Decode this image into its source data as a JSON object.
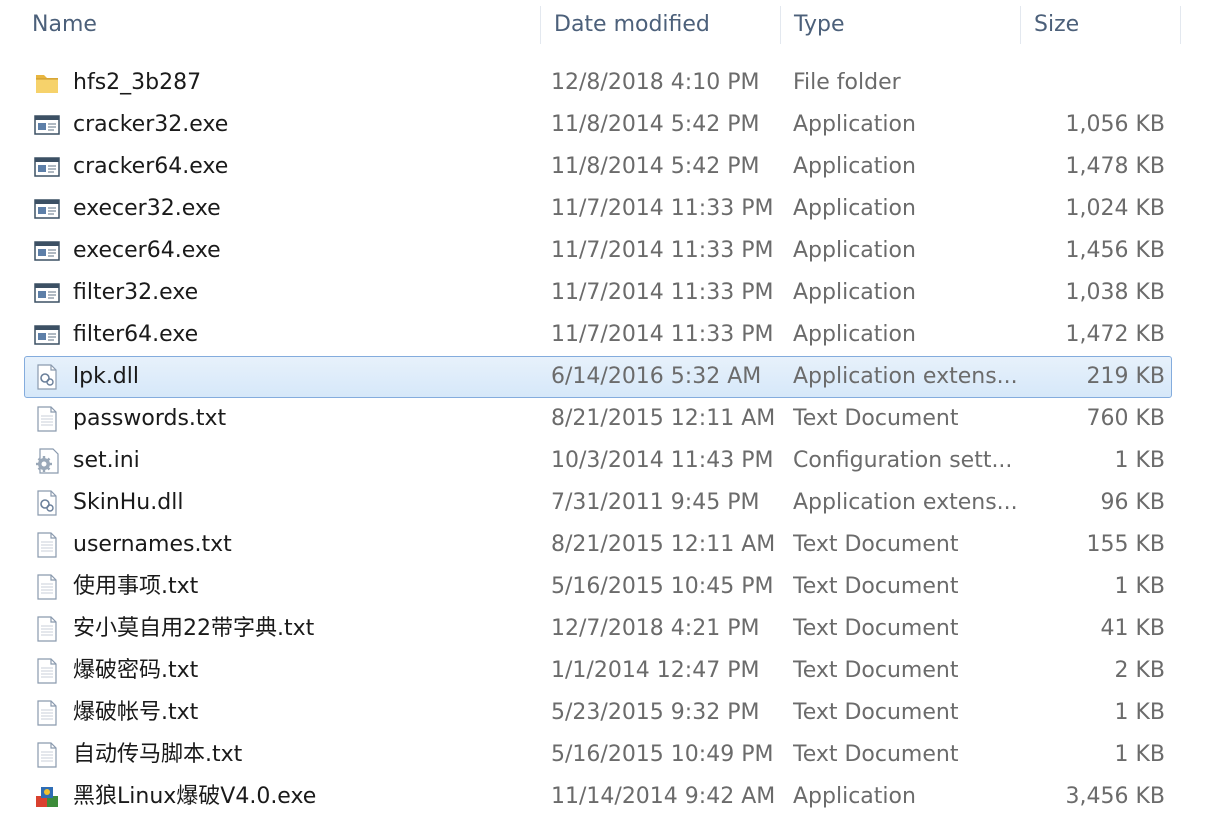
{
  "columns": {
    "name": "Name",
    "date": "Date modified",
    "type": "Type",
    "size": "Size"
  },
  "files": [
    {
      "name": "hfs2_3b287",
      "date": "12/8/2018 4:10 PM",
      "type": "File folder",
      "size": "",
      "icon": "folder-icon"
    },
    {
      "name": "cracker32.exe",
      "date": "11/8/2014 5:42 PM",
      "type": "Application",
      "size": "1,056 KB",
      "icon": "application-icon"
    },
    {
      "name": "cracker64.exe",
      "date": "11/8/2014 5:42 PM",
      "type": "Application",
      "size": "1,478 KB",
      "icon": "application-icon"
    },
    {
      "name": "execer32.exe",
      "date": "11/7/2014 11:33 PM",
      "type": "Application",
      "size": "1,024 KB",
      "icon": "application-icon"
    },
    {
      "name": "execer64.exe",
      "date": "11/7/2014 11:33 PM",
      "type": "Application",
      "size": "1,456 KB",
      "icon": "application-icon"
    },
    {
      "name": "filter32.exe",
      "date": "11/7/2014 11:33 PM",
      "type": "Application",
      "size": "1,038 KB",
      "icon": "application-icon"
    },
    {
      "name": "filter64.exe",
      "date": "11/7/2014 11:33 PM",
      "type": "Application",
      "size": "1,472 KB",
      "icon": "application-icon"
    },
    {
      "name": "lpk.dll",
      "date": "6/14/2016 5:32 AM",
      "type": "Application extens...",
      "size": "219 KB",
      "icon": "dll-icon",
      "selected": true
    },
    {
      "name": "passwords.txt",
      "date": "8/21/2015 12:11 AM",
      "type": "Text Document",
      "size": "760 KB",
      "icon": "text-document-icon"
    },
    {
      "name": "set.ini",
      "date": "10/3/2014 11:43 PM",
      "type": "Configuration sett...",
      "size": "1 KB",
      "icon": "config-icon"
    },
    {
      "name": "SkinHu.dll",
      "date": "7/31/2011 9:45 PM",
      "type": "Application extens...",
      "size": "96 KB",
      "icon": "dll-icon"
    },
    {
      "name": "usernames.txt",
      "date": "8/21/2015 12:11 AM",
      "type": "Text Document",
      "size": "155 KB",
      "icon": "text-document-icon"
    },
    {
      "name": "使用事项.txt",
      "date": "5/16/2015 10:45 PM",
      "type": "Text Document",
      "size": "1 KB",
      "icon": "text-document-icon"
    },
    {
      "name": "安小莫自用22带字典.txt",
      "date": "12/7/2018 4:21 PM",
      "type": "Text Document",
      "size": "41 KB",
      "icon": "text-document-icon"
    },
    {
      "name": "爆破密码.txt",
      "date": "1/1/2014 12:47 PM",
      "type": "Text Document",
      "size": "2 KB",
      "icon": "text-document-icon"
    },
    {
      "name": "爆破帐号.txt",
      "date": "5/23/2015 9:32 PM",
      "type": "Text Document",
      "size": "1 KB",
      "icon": "text-document-icon"
    },
    {
      "name": "自动传马脚本.txt",
      "date": "5/16/2015 10:49 PM",
      "type": "Text Document",
      "size": "1 KB",
      "icon": "text-document-icon"
    },
    {
      "name": "黑狼Linux爆破V4.0.exe",
      "date": "11/14/2014 9:42 AM",
      "type": "Application",
      "size": "3,456 KB",
      "icon": "installer-icon"
    }
  ]
}
